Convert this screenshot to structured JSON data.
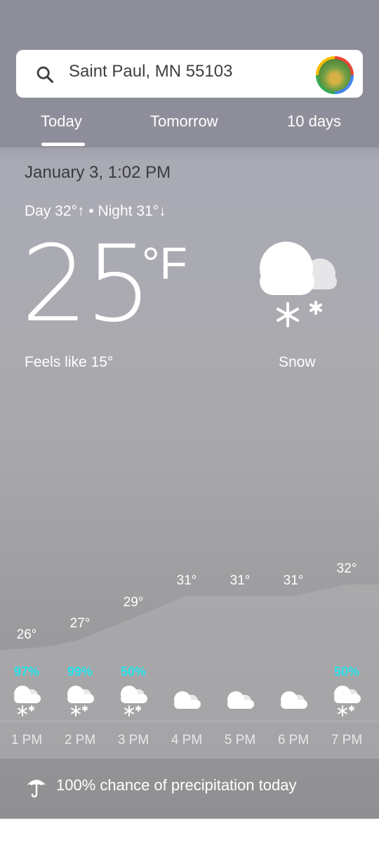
{
  "search": {
    "query": "Saint Paul, MN 55103"
  },
  "tabs": [
    "Today",
    "Tomorrow",
    "10 days"
  ],
  "current": {
    "date": "January 3, 1:02 PM",
    "day_night": "Day 32°↑ • Night 31°↓",
    "temp": "25",
    "unit": "°F",
    "feels_like": "Feels like 15°",
    "condition": "Snow",
    "icon": "cloud-snow-icon"
  },
  "hourly": [
    {
      "time": "1 PM",
      "temp": "26°",
      "precip": "97%",
      "icon": "cloud-snow-icon"
    },
    {
      "time": "2 PM",
      "temp": "27°",
      "precip": "99%",
      "icon": "cloud-snow-icon"
    },
    {
      "time": "3 PM",
      "temp": "29°",
      "precip": "50%",
      "icon": "cloud-snow-icon"
    },
    {
      "time": "4 PM",
      "temp": "31°",
      "precip": "",
      "icon": "cloud-icon"
    },
    {
      "time": "5 PM",
      "temp": "31°",
      "precip": "",
      "icon": "cloud-icon"
    },
    {
      "time": "6 PM",
      "temp": "31°",
      "precip": "",
      "icon": "cloud-icon"
    },
    {
      "time": "7 PM",
      "temp": "32°",
      "precip": "50%",
      "icon": "cloud-snow-icon"
    }
  ],
  "precip_summary": "100% chance of precipitation today",
  "colors": {
    "precip": "#27e4ee",
    "date_text": "#3a3b40"
  }
}
